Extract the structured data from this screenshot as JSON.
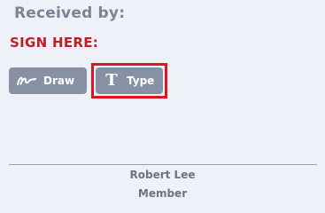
{
  "header": {
    "received_by_label": "Received by:",
    "sign_here_label": "SIGN HERE:"
  },
  "signature_modes": {
    "draw": {
      "label": "Draw",
      "icon": "signature-scribble-icon"
    },
    "type": {
      "label": "Type",
      "icon": "text-t-icon",
      "highlighted": true
    }
  },
  "signer": {
    "name": "Robert Lee",
    "role": "Member"
  },
  "colors": {
    "background": "#eef1f7",
    "muted_text": "#7a8496",
    "sign_here_red": "#bd1e2a",
    "button_bg": "#8891a4",
    "highlight_red": "#e0151f",
    "divider": "#9aa1ae"
  }
}
